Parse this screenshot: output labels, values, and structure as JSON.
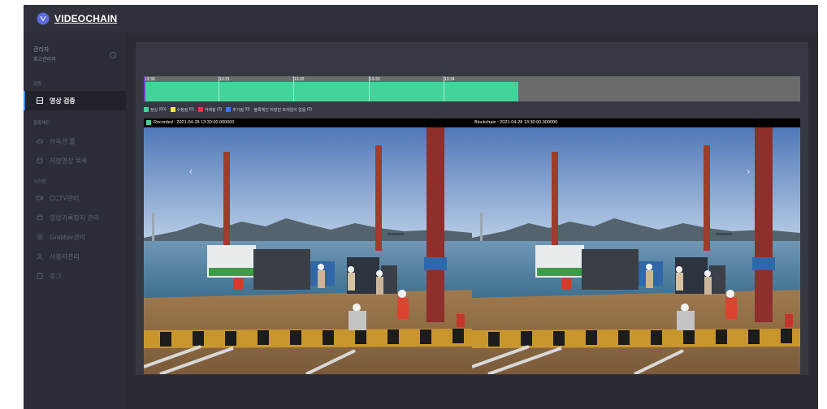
{
  "brand": {
    "name": "VIDEOCHAIN"
  },
  "user": {
    "name": "관리자",
    "role": "최고관리자"
  },
  "sidebar": {
    "section_verify": "검증",
    "section_blockchain": "블록체인",
    "section_system": "시스템",
    "items": [
      {
        "label": "영상 검증",
        "icon": "film-icon",
        "active": true
      },
      {
        "label": "카옥션 풀",
        "icon": "cloud-icon",
        "active": false
      },
      {
        "label": "저장영상 목록",
        "icon": "database-icon",
        "active": false
      },
      {
        "label": "CCTV관리",
        "icon": "camera-icon",
        "active": false
      },
      {
        "label": "영상기록장치 관리",
        "icon": "database-icon",
        "active": false
      },
      {
        "label": "Grabber관리",
        "icon": "gear-icon",
        "active": false
      },
      {
        "label": "사용자관리",
        "icon": "user-icon",
        "active": false
      },
      {
        "label": "로그",
        "icon": "clipboard-icon",
        "active": false
      }
    ]
  },
  "timeline": {
    "labels": [
      "13:30",
      "13:31",
      "13:32",
      "13:33",
      "13:34"
    ],
    "recorded_fraction": 0.57
  },
  "legend": [
    {
      "label": "정상",
      "count": "(60)",
      "color": "#44d39b"
    },
    {
      "label": "수정됨",
      "count": "(0)",
      "color": "#f5e63b"
    },
    {
      "label": "삭제됨",
      "count": "(0)",
      "color": "#ff2a4a"
    },
    {
      "label": "추가됨",
      "count": "(0)",
      "color": "#3b74ff"
    },
    {
      "label": "블록체인 저장된 프레임이 없음",
      "count": "(0)",
      "color": ""
    }
  ],
  "video": {
    "recorded_label": "Recorded : 2021-04-28 13:30:00.000000",
    "blockchain_label": "Blockchain : 2021-04-28 13:30:00.000000",
    "prev_icon": "‹",
    "next_icon": "›"
  },
  "colors": {
    "accent": "#3c8ce7",
    "normal": "#44d39b",
    "background": "#2f323b"
  }
}
